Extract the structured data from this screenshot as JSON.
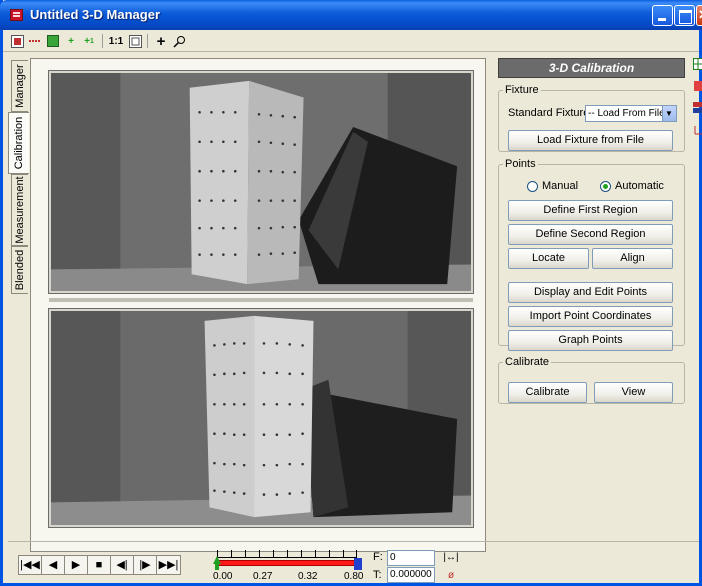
{
  "window": {
    "title": "Untitled 3-D Manager"
  },
  "toolbar": {
    "icons": [
      "grid-icon",
      "link-icon",
      "square-icon",
      "add-point-icon",
      "add-point-alt-icon",
      "one-to-one-icon",
      "fit-icon",
      "crosshair-icon",
      "zoom-icon"
    ],
    "one_to_one_label": "1:1"
  },
  "left_tabs": [
    {
      "label": "Manager"
    },
    {
      "label": "Calibration",
      "active": true
    },
    {
      "label": "Measurement"
    },
    {
      "label": "Blended"
    }
  ],
  "panel": {
    "title": "3-D Calibration",
    "fixture": {
      "legend": "Fixture",
      "standard_label": "Standard Fixture",
      "select_value": "-- Load From File --",
      "load_button": "Load Fixture from File"
    },
    "points": {
      "legend": "Points",
      "manual_label": "Manual",
      "automatic_label": "Automatic",
      "selected": "Automatic",
      "define_first": "Define First Region",
      "define_second": "Define Second Region",
      "locate": "Locate",
      "align": "Align",
      "display_edit": "Display and Edit Points",
      "import": "Import Point Coordinates",
      "graph": "Graph Points"
    },
    "calibrate": {
      "legend": "Calibrate",
      "calibrate_button": "Calibrate",
      "view_button": "View"
    }
  },
  "transport": {
    "buttons": [
      "first-frame-icon",
      "step-back-icon",
      "play-icon",
      "stop-icon",
      "prev-marker-icon",
      "next-marker-icon",
      "last-frame-icon"
    ],
    "slider_labels": [
      "0.00",
      "0.27",
      "0.32",
      "0.80"
    ],
    "frame_label": "F:",
    "frame_value": "0",
    "time_label": "T:",
    "time_value": "0.000000"
  },
  "colors": {
    "title_bar": "#0a5fe0",
    "panel_header": "#6b6b6b",
    "slider_bar": "#ff1a1a"
  }
}
